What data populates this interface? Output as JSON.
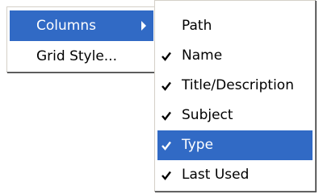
{
  "main_menu": {
    "items": [
      {
        "label": "Columns",
        "has_submenu": true,
        "selected": true
      },
      {
        "label": "Grid Style...",
        "has_submenu": false,
        "selected": false
      }
    ]
  },
  "columns_submenu": {
    "items": [
      {
        "label": "Path",
        "checked": false,
        "selected": false
      },
      {
        "label": "Name",
        "checked": true,
        "selected": false
      },
      {
        "label": "Title/Description",
        "checked": true,
        "selected": false
      },
      {
        "label": "Subject",
        "checked": true,
        "selected": false
      },
      {
        "label": "Type",
        "checked": true,
        "selected": true
      },
      {
        "label": "Last Used",
        "checked": true,
        "selected": false
      }
    ]
  },
  "colors": {
    "highlight": "#316ac5",
    "highlight_text": "#ffffff",
    "menu_background": "#ffffff"
  }
}
